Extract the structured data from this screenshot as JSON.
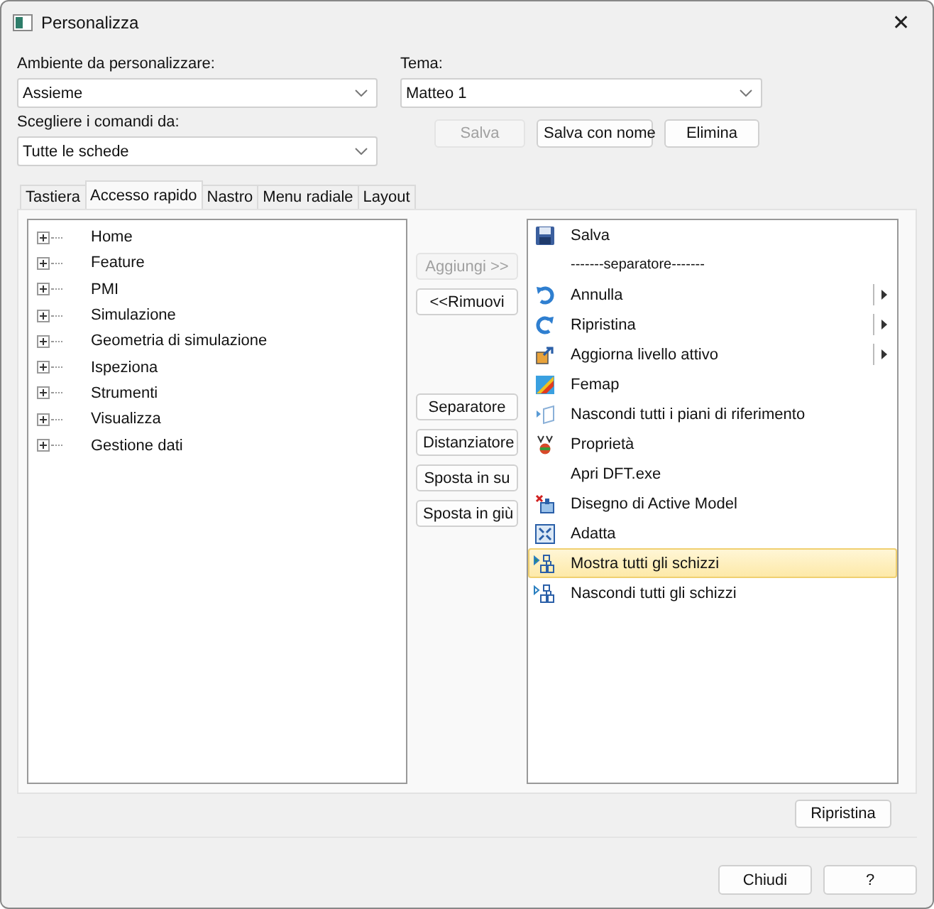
{
  "window": {
    "title": "Personalizza",
    "close": "✕"
  },
  "environment": {
    "label": "Ambiente da personalizzare:",
    "value": "Assieme"
  },
  "theme": {
    "label": "Tema:",
    "value": "Matteo 1"
  },
  "commands_from": {
    "label": "Scegliere i comandi da:",
    "value": "Tutte le schede"
  },
  "theme_buttons": [
    {
      "label": "Salva",
      "disabled": true
    },
    {
      "label": "Salva con nome",
      "disabled": false
    },
    {
      "label": "Elimina",
      "disabled": false
    }
  ],
  "tabs": [
    {
      "label": "Tastiera",
      "selected": false
    },
    {
      "label": "Accesso rapido",
      "selected": true
    },
    {
      "label": "Nastro",
      "selected": false
    },
    {
      "label": "Menu radiale",
      "selected": false
    },
    {
      "label": "Layout",
      "selected": false
    }
  ],
  "tree": [
    {
      "label": "Home",
      "expanded": false
    },
    {
      "label": "Feature",
      "expanded": false
    },
    {
      "label": "PMI",
      "expanded": false
    },
    {
      "label": "Simulazione",
      "expanded": false
    },
    {
      "label": "Geometria di simulazione",
      "expanded": false
    },
    {
      "label": "Ispeziona",
      "expanded": false
    },
    {
      "label": "Strumenti",
      "expanded": false
    },
    {
      "label": "Visualizza",
      "expanded": false
    },
    {
      "label": "Gestione dati",
      "expanded": false
    }
  ],
  "move_buttons": [
    {
      "label": "Aggiungi >>",
      "disabled": true
    },
    {
      "label": "<<Rimuovi",
      "disabled": false
    }
  ],
  "arrange_buttons": [
    {
      "label": "Separatore",
      "disabled": false
    },
    {
      "label": "Distanziatore",
      "disabled": false
    },
    {
      "label": "Sposta in su",
      "disabled": false
    },
    {
      "label": "Sposta in giù",
      "disabled": false
    }
  ],
  "quick_access": [
    {
      "kind": "command",
      "label": "Salva",
      "submenu": false,
      "selected": false
    },
    {
      "kind": "separator",
      "label": "-------separatore-------",
      "submenu": false,
      "selected": false
    },
    {
      "kind": "command",
      "label": "Annulla",
      "submenu": true,
      "selected": false
    },
    {
      "kind": "command",
      "label": "Ripristina",
      "submenu": true,
      "selected": false
    },
    {
      "kind": "command",
      "label": "Aggiorna livello attivo",
      "submenu": true,
      "selected": false
    },
    {
      "kind": "command",
      "label": "Femap",
      "submenu": false,
      "selected": false
    },
    {
      "kind": "command",
      "label": "Nascondi tutti i piani di riferimento",
      "submenu": false,
      "selected": false
    },
    {
      "kind": "command",
      "label": "Proprietà",
      "submenu": false,
      "selected": false
    },
    {
      "kind": "command",
      "label": "Apri DFT.exe",
      "submenu": false,
      "selected": false
    },
    {
      "kind": "command",
      "label": "Disegno di Active Model",
      "submenu": false,
      "selected": false
    },
    {
      "kind": "command",
      "label": "Adatta",
      "submenu": false,
      "selected": false
    },
    {
      "kind": "command",
      "label": "Mostra tutti gli schizzi",
      "submenu": false,
      "selected": true
    },
    {
      "kind": "command",
      "label": "Nascondi tutti gli schizzi",
      "submenu": false,
      "selected": false
    }
  ],
  "reset_button": "Ripristina",
  "footer_buttons": [
    "Chiudi",
    "?"
  ]
}
